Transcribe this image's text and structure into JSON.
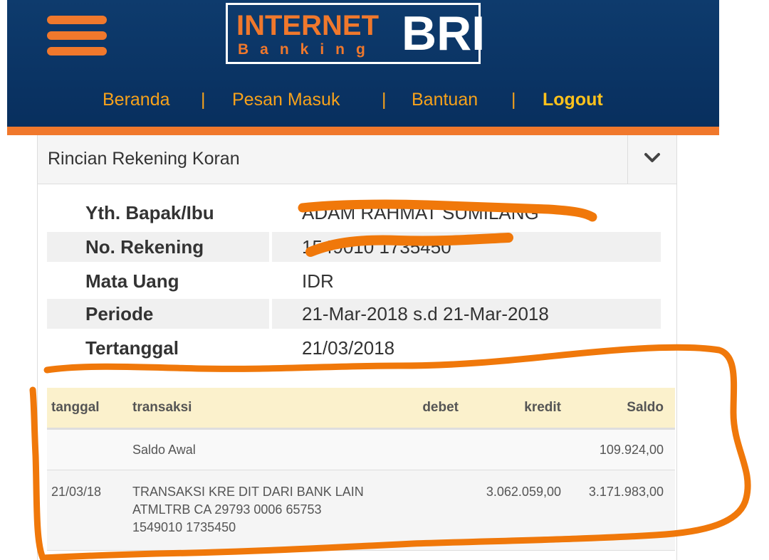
{
  "header": {
    "logo": {
      "line1": "INTERNET",
      "line2": "Banking",
      "brand": "BRI"
    },
    "nav": {
      "home": "Beranda",
      "inbox": "Pesan Masuk",
      "help": "Bantuan",
      "logout": "Logout",
      "separator": "|"
    }
  },
  "panel": {
    "title": "Rincian Rekening Koran"
  },
  "account_info": {
    "rows": [
      {
        "label": "Yth. Bapak/Ibu",
        "value": "ADAM RAHMAT SUMILANG"
      },
      {
        "label": "No. Rekening",
        "value": "1549010 1735450"
      },
      {
        "label": "Mata Uang",
        "value": "IDR"
      },
      {
        "label": "Periode",
        "value": "21-Mar-2018 s.d 21-Mar-2018"
      },
      {
        "label": "Tertanggal",
        "value": "21/03/2018"
      }
    ]
  },
  "transactions": {
    "headers": {
      "date": "tanggal",
      "description": "transaksi",
      "debit": "debet",
      "credit": "kredit",
      "balance": "Saldo"
    },
    "opening": {
      "description": "Saldo Awal",
      "balance": "109.924,00"
    },
    "rows": [
      {
        "date": "21/03/18",
        "description": "TRANSAKSI KRE DIT DARI BANK LAIN ATMLTRB CA 29793 0006 65753 1549010 1735450",
        "debit": "",
        "credit": "3.062.059,00",
        "balance": "3.171.983,00"
      }
    ]
  },
  "colors": {
    "header_bg": "#0b3768",
    "accent_orange": "#f0782c",
    "nav_text": "#f7a21b",
    "table_header_bg": "#fbf1cc"
  },
  "icons": {
    "menu": "hamburger-icon",
    "toggle": "chevron-down-icon"
  }
}
